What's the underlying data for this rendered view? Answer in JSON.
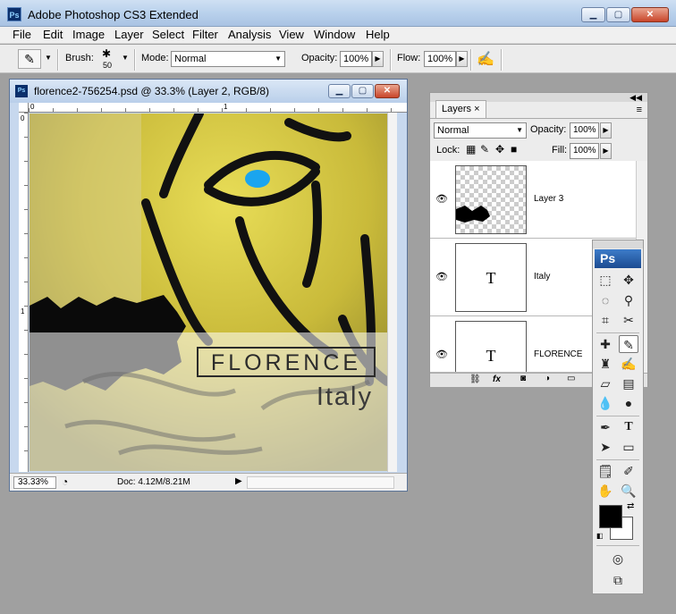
{
  "app": {
    "title": "Adobe Photoshop CS3 Extended",
    "icon_text": "Ps"
  },
  "window_buttons": {
    "minimize": "▁",
    "maximize": "▢",
    "close": "✕"
  },
  "menu": [
    "File",
    "Edit",
    "Image",
    "Layer",
    "Select",
    "Filter",
    "Analysis",
    "View",
    "Window",
    "Help"
  ],
  "options": {
    "brush_label": "Brush:",
    "brush_size": "50",
    "mode_label": "Mode:",
    "mode_value": "Normal",
    "opacity_label": "Opacity:",
    "opacity_value": "100%",
    "flow_label": "Flow:",
    "flow_value": "100%"
  },
  "document": {
    "title": "florence2-756254.psd @ 33.3% (Layer 2, RGB/8)",
    "icon_text": "Ps",
    "ruler_h": [
      "0",
      "1"
    ],
    "ruler_v": [
      "0",
      "1"
    ],
    "zoom": "33.33%",
    "doc_info": "Doc: 4.12M/8.21M",
    "artwork_title": "FLORENCE",
    "artwork_subtitle": "Italy"
  },
  "layers_panel": {
    "tab": "Layers",
    "tab_close": "×",
    "blend_mode": "Normal",
    "opacity_label": "Opacity:",
    "opacity_value": "100%",
    "lock_label": "Lock:",
    "fill_label": "Fill:",
    "fill_value": "100%",
    "layers": [
      {
        "name": "Layer 3",
        "type": "raster"
      },
      {
        "name": "Italy",
        "type": "text",
        "thumb": "T"
      },
      {
        "name": "FLORENCE",
        "type": "text",
        "thumb": "T"
      }
    ],
    "footer_icons": [
      "link-icon",
      "fx-icon",
      "mask-icon",
      "adjustment-icon",
      "group-icon"
    ],
    "footer_fx": "fx"
  },
  "tools_panel": {
    "badge": "Ps"
  },
  "colors": {
    "foreground": "#000000",
    "background": "#ffffff",
    "workspace": "#a0a0a0"
  }
}
